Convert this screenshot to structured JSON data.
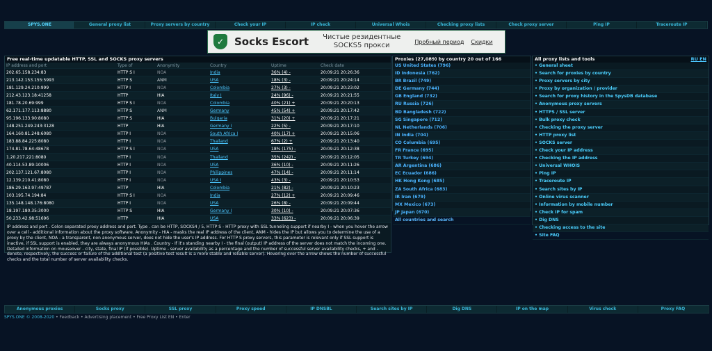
{
  "topnav": [
    "SPYS.ONE",
    "General proxy list",
    "Proxy servers by country",
    "Check your IP",
    "IP check",
    "Universal Whois",
    "Checking proxy lists",
    "Check proxy server",
    "Ping IP",
    "Traceroute IP"
  ],
  "banner": {
    "brand": "Socks Escort",
    "slogan1": "Чистые резидентные",
    "slogan2": "SOCKS5 прокси",
    "link1": "Пробный период",
    "link2": "Скидки"
  },
  "left": {
    "title": "Free real-time updatable HTTP, SSL and SOCKS proxy servers",
    "headers": [
      "IP address and port",
      "Type of",
      "Anonymity",
      "Country",
      "Uptime",
      "Check date"
    ],
    "rows": [
      [
        "202.65.158.234:83",
        "HTTP S I",
        "NOA",
        "India",
        "36% (4) -",
        "20:09:21 20:26:36"
      ],
      [
        "213.142.153.155:5993",
        "HTTP S",
        "ANM",
        "USA",
        "18% (3) -",
        "20:09:21 20:24:14"
      ],
      [
        "181.129.24.210:999",
        "HTTP I",
        "NOA",
        "Colombia",
        "27% (3) -",
        "20:09:21 20:23:02"
      ],
      [
        "212.43.123.18:41258",
        "HTTP",
        "HIA",
        "Italy I",
        "24% (96) -",
        "20:09:21 20:21:55"
      ],
      [
        "181.78.20.69:999",
        "HTTP S I",
        "NOA",
        "Colombia",
        "40% (21) +",
        "20:09:21 20:20:13"
      ],
      [
        "62.171.177.113:8880",
        "HTTP S",
        "ANM",
        "Germany",
        "45% (54) +",
        "20:09:21 20:17:42"
      ],
      [
        "95.196.133.90:8080",
        "HTTP S",
        "HIA",
        "Bulgaria",
        "31% (20) +",
        "20:09:21 20:17:21"
      ],
      [
        "148.251.249.243:3128",
        "HTTP",
        "HIA",
        "Germany I",
        "22% (5) -",
        "20:09:21 20:17:10"
      ],
      [
        "164.160.81.248:6080",
        "HTTP I",
        "NOA",
        "South Africa I",
        "40% (17) +",
        "20:09:21 20:15:06"
      ],
      [
        "183.88.84.225:8080",
        "HTTP I",
        "NOA",
        "Thailand",
        "67% (2) +",
        "20:09:21 20:13:40"
      ],
      [
        "174.81.78.64:48678",
        "HTTP S I",
        "NOA",
        "USA",
        "18% (175) -",
        "20:09:21 20:12:38"
      ],
      [
        "1.20.217.221:8080",
        "HTTP I",
        "NOA",
        "Thailand",
        "35% (242) -",
        "20:09:21 20:12:05"
      ],
      [
        "40.114.53.89:10006",
        "HTTP I",
        "NOA",
        "USA",
        "36% (10) -",
        "20:09:21 20:11:26"
      ],
      [
        "202.137.121.67:8080",
        "HTTP I",
        "NOA",
        "Philippines",
        "47% (14) -",
        "20:09:21 20:11:14"
      ],
      [
        "12.139.210.41:8080",
        "HTTP I",
        "NOA",
        "USA I",
        "43% (3) -",
        "20:09:21 20:10:53"
      ],
      [
        "186.29.163.97:49787",
        "HTTP",
        "HIA",
        "Colombia",
        "21% (82) -",
        "20:09:21 20:10:23"
      ],
      [
        "103.195.74.194:84",
        "HTTP S I",
        "NOA",
        "India",
        "27% (12) +",
        "20:09:21 20:09:46"
      ],
      [
        "135.148.148.176:8080",
        "HTTP I",
        "NOA",
        "USA",
        "26% (8) -",
        "20:09:21 20:09:44"
      ],
      [
        "18.197.180.35:3000",
        "HTTP S",
        "HIA",
        "Germany I",
        "30% (10) -",
        "20:09:21 20:07:36"
      ],
      [
        "50.233.42.98:51696",
        "HTTP",
        "HIA",
        "USA",
        "33% (623) -",
        "20:09:21 20:06:39"
      ]
    ],
    "note": "IP address and port . Colon separated proxy address and port. Type . can be HTTP, SOCKS4 / 5, HTTP S - HTTP proxy with SSL tunneling support if nearby I - when you hover the arrow over a cell - additional information about the proxy software. Anonymity - HIA - masks the real IP address of the client, ANM - hides the IP but allows you to determine the use of a proxy by the client, NOA - a transparent, non anonymous server, does not hide the user's IP address. For HTTP S proxy servers, this parameter is relevant only if SSL support is inactive, if SSL support is enabled, they are always anonymous HIAs . Country - If it's standing nearby I - the final (output) IP address of the server does not match the incoming one. Detailed information on mouseover - city, state, final IP (if possible). Uptime - server availability as a percentage and the number of successful server availability checks, + and - denote, respectively, the success or failure of the additional test (a positive test result is a more stable and reliable server). Hovering over the arrow shows the number of successful checks and the total number of server availability checks."
  },
  "mid": {
    "title": "Proxies (27,089) by country 20 out of 166",
    "rows": [
      [
        "US",
        "United States",
        "(796)"
      ],
      [
        "ID",
        "Indonesia",
        "(762)"
      ],
      [
        "BR",
        "Brazil",
        "(749)"
      ],
      [
        "DE",
        "Germany",
        "(744)"
      ],
      [
        "GB",
        "England",
        "(732)"
      ],
      [
        "RU",
        "Russia",
        "(726)"
      ],
      [
        "BD",
        "Bangladesh",
        "(722)"
      ],
      [
        "SG",
        "Singapore",
        "(712)"
      ],
      [
        "NL",
        "Netherlands",
        "(706)"
      ],
      [
        "IN",
        "India",
        "(704)"
      ],
      [
        "CO",
        "Columbia",
        "(695)"
      ],
      [
        "FR",
        "France",
        "(695)"
      ],
      [
        "TR",
        "Turkey",
        "(694)"
      ],
      [
        "AR",
        "Argentina",
        "(686)"
      ],
      [
        "EC",
        "Ecuador",
        "(686)"
      ],
      [
        "HK",
        "Hong Kong",
        "(685)"
      ],
      [
        "ZA",
        "South Africa",
        "(683)"
      ],
      [
        "IR",
        "Iran",
        "(679)"
      ],
      [
        "MX",
        "Mexico",
        "(673)"
      ],
      [
        "JP",
        "Japan",
        "(670)"
      ]
    ],
    "footer": "All countries and search"
  },
  "right": {
    "title": "All proxy lists and tools",
    "lang": "RU EN",
    "items": [
      "• General sheet",
      "• Search for proxies by country",
      "• Proxy servers by city",
      "• Proxy by organization / provider",
      "• Search for proxy history in the SpysDB database",
      "• Anonymous proxy servers",
      "• HTTPS / SSL server",
      "• Bulk proxy check",
      "• Checking the proxy server",
      "• HTTP proxy list",
      "• SOCKS server",
      "• Check your IP address",
      "• Checking the IP address",
      "• Universal WHOIS",
      "• Ping IP",
      "• Traceroute IP",
      "• Search sites by IP",
      "• Online virus scanner",
      "• Information by mobile number",
      "• Check IP for spam",
      "• Dig DNS",
      "• Checking access to the site",
      "• Site FAQ"
    ]
  },
  "botnav": [
    "Anonymous proxies",
    "Socks proxy",
    "SSL proxy",
    "Proxy speed",
    "IP DNSBL",
    "Search sites by IP",
    "Dig DNS",
    "IP on the map",
    "Virus check",
    "Proxy FAQ"
  ],
  "footer": {
    "copy": "SPYS.ONE © 2008-2020",
    "rest": " • Feedback • Advertising placement • Free Proxy List EN • Enter"
  }
}
